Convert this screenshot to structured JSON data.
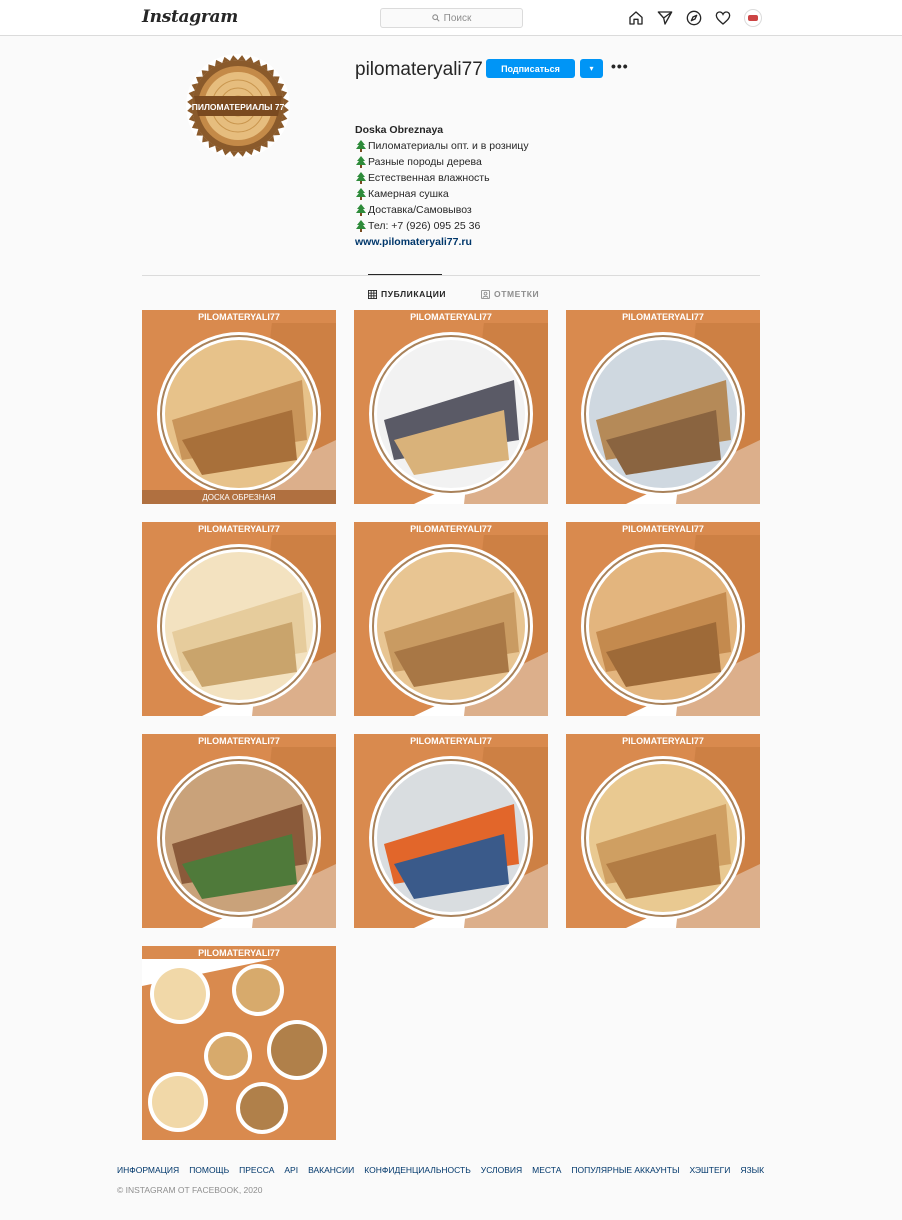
{
  "topbar": {
    "logo_text": "Instagram",
    "search_placeholder": "Поиск"
  },
  "profile": {
    "username": "pilomateryali77",
    "follow_label": "Подписаться",
    "dropdown_symbol": "▾",
    "more_symbol": "•••",
    "avatar_text": "ПИЛОМАТЕРИАЛЫ 77",
    "bio": {
      "name": "Doska Obreznaya",
      "lines": [
        "Пиломатериалы опт. и в розницу",
        "Разные породы дерева",
        "Естественная влажность",
        "Камерная сушка",
        "Доставка/Самовывоз",
        "Тел: +7 (926) 095 25 36"
      ],
      "website": "www.pilomateryali77.ru"
    }
  },
  "tabs": {
    "posts": "ПУБЛИКАЦИИ",
    "tagged": "ОТМЕТКИ"
  },
  "posts": {
    "brand": "PILOMATERYALI77",
    "first_caption": "ДОСКА ОБРЕЗНАЯ"
  },
  "footer": {
    "links": [
      "ИНФОРМАЦИЯ",
      "ПОМОЩЬ",
      "ПРЕССА",
      "API",
      "ВАКАНСИИ",
      "КОНФИДЕНЦИАЛЬНОСТЬ",
      "УСЛОВИЯ",
      "МЕСТА",
      "ПОПУЛЯРНЫЕ АККАУНТЫ",
      "ХЭШТЕГИ",
      "ЯЗЫК"
    ],
    "copyright": "© INSTAGRAM ОТ FACEBOOK, 2020"
  },
  "colors": {
    "accent_blue": "#0095f6",
    "brand_orange": "#d98a4e",
    "link_dark_blue": "#00376b"
  }
}
